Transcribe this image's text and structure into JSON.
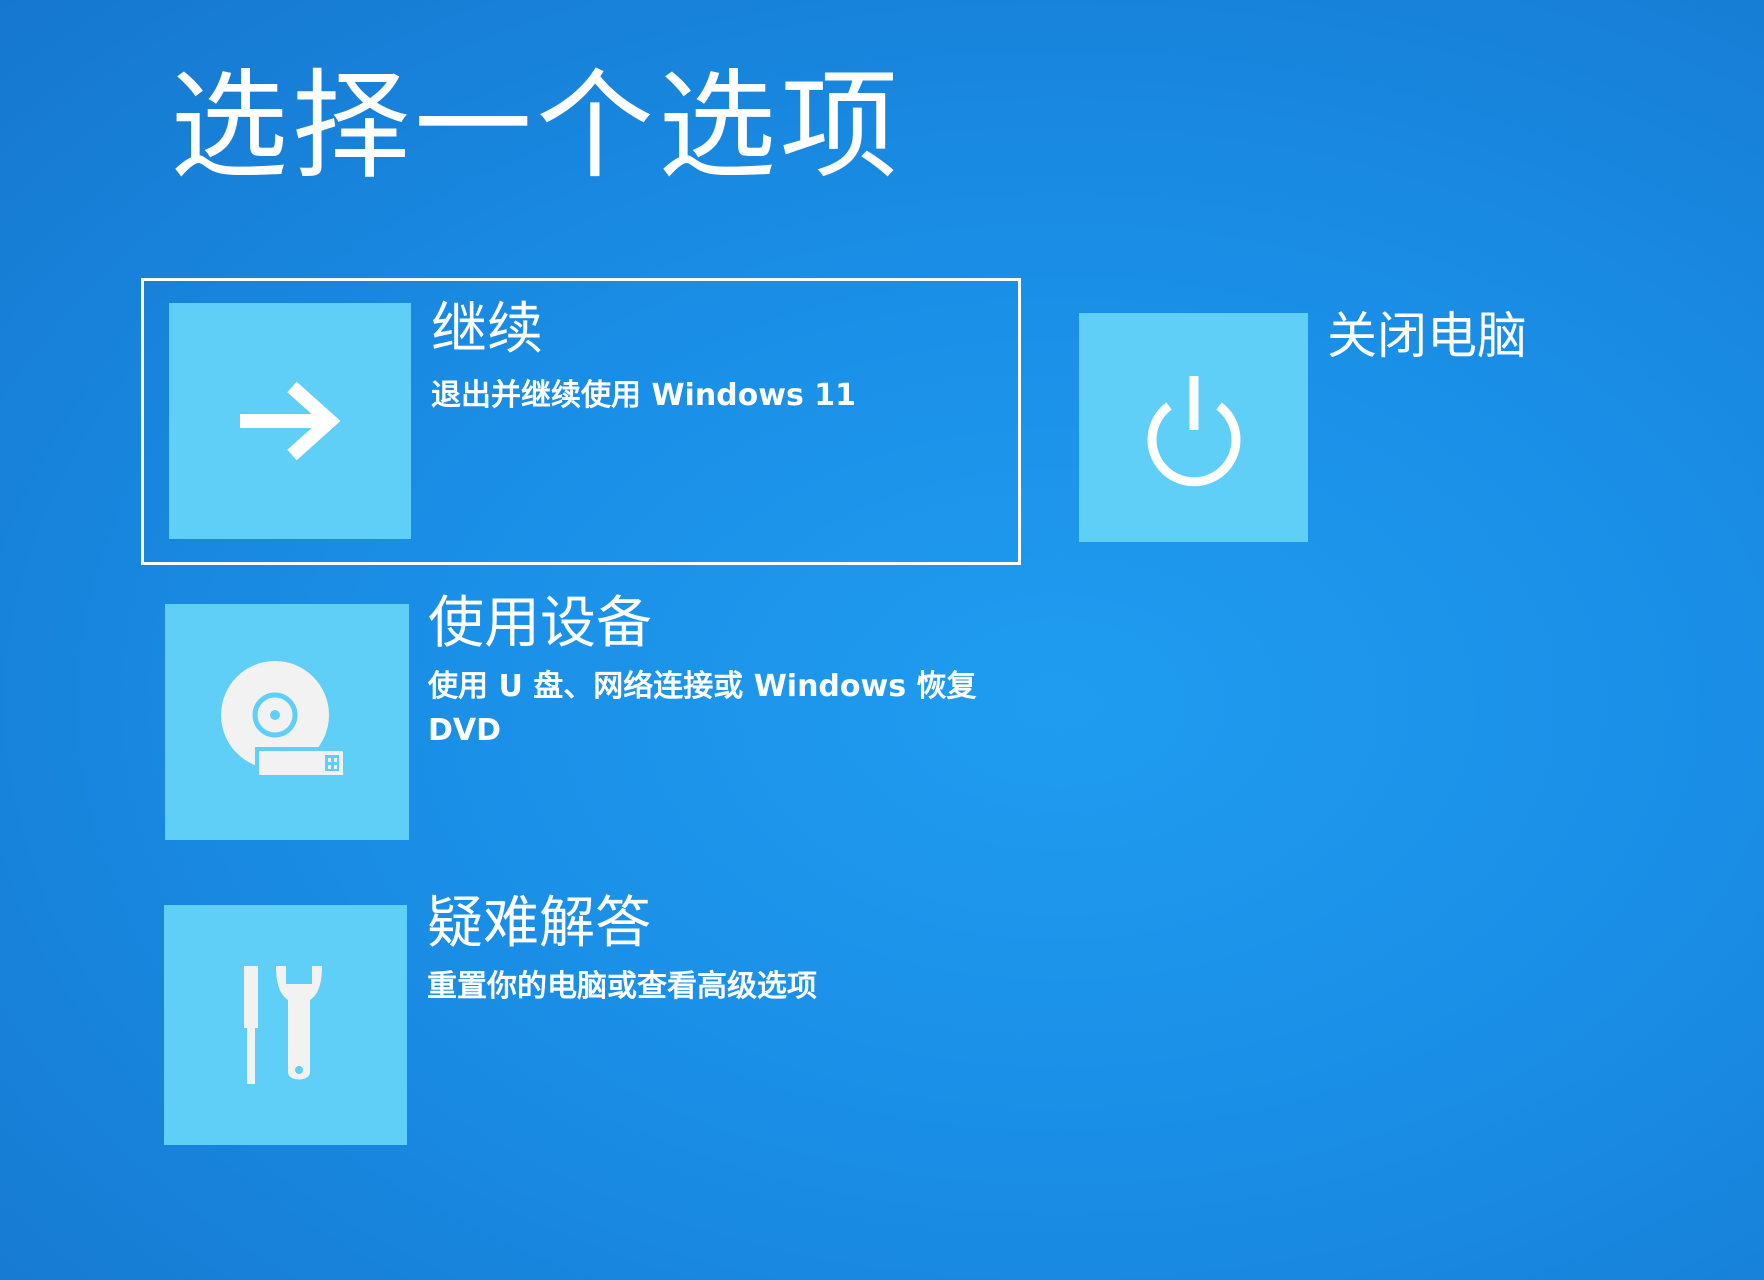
{
  "page": {
    "title": "选择一个选项"
  },
  "options": {
    "continue": {
      "title": "继续",
      "description": "退出并继续使用 Windows 11",
      "icon": "arrow-right-icon"
    },
    "use_device": {
      "title": "使用设备",
      "description": "使用 U 盘、网络连接或 Windows 恢复 DVD",
      "icon": "disc-usb-icon"
    },
    "troubleshoot": {
      "title": "疑难解答",
      "description": "重置你的电脑或查看高级选项",
      "icon": "tools-icon"
    },
    "shutdown": {
      "title": "关闭电脑",
      "icon": "power-icon"
    }
  },
  "colors": {
    "background": "#1a8ee6",
    "tile": "#5fcff8",
    "text": "#ffffff"
  }
}
